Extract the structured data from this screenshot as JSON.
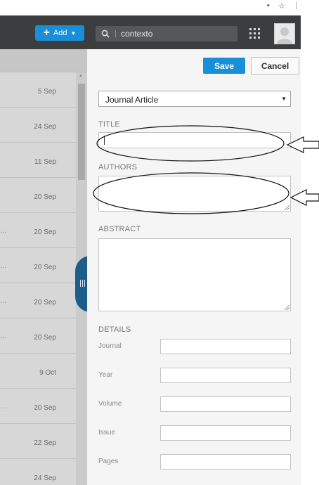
{
  "header": {
    "add_label": "Add",
    "search_value": "contexto"
  },
  "list": {
    "rows": [
      {
        "date": "5 Sep",
        "truncated": false
      },
      {
        "date": "24 Sep",
        "truncated": false
      },
      {
        "date": "11 Sep",
        "truncated": false
      },
      {
        "date": "20 Sep",
        "truncated": false
      },
      {
        "date": "20 Sep",
        "truncated": true
      },
      {
        "date": "20 Sep",
        "truncated": true
      },
      {
        "date": "20 Sep",
        "truncated": true
      },
      {
        "date": "20 Sep",
        "truncated": true
      },
      {
        "date": "9 Oct",
        "truncated": false
      },
      {
        "date": "20 Sep",
        "truncated": true
      },
      {
        "date": "22 Sep",
        "truncated": false
      },
      {
        "date": "24 Sep",
        "truncated": false
      }
    ],
    "ellipsis": "…"
  },
  "panel": {
    "save_label": "Save",
    "cancel_label": "Cancel",
    "document_type": "Journal Article",
    "title_label": "TITLE",
    "title_value": "",
    "authors_label": "AUTHORS",
    "authors_value": "",
    "abstract_label": "ABSTRACT",
    "abstract_value": "",
    "details_label": "DETAILS",
    "details": [
      {
        "key": "journal",
        "label": "Journal",
        "value": ""
      },
      {
        "key": "year",
        "label": "Year",
        "value": ""
      },
      {
        "key": "volume",
        "label": "Volume",
        "value": ""
      },
      {
        "key": "issue",
        "label": "Issue",
        "value": ""
      },
      {
        "key": "pages",
        "label": "Pages",
        "value": ""
      }
    ]
  },
  "colors": {
    "header_bg": "#3b3d3f",
    "accent_blue": "#1a8fd9",
    "panel_bg": "#f5f5f5",
    "list_bg": "#d7d7d7",
    "handle_blue": "#1d5d8a"
  },
  "icons": [
    "plus-icon",
    "chevron-down-icon",
    "search-icon",
    "apps-grid-icon",
    "avatar",
    "panel-handle-icon",
    "arrow-left-icon"
  ]
}
